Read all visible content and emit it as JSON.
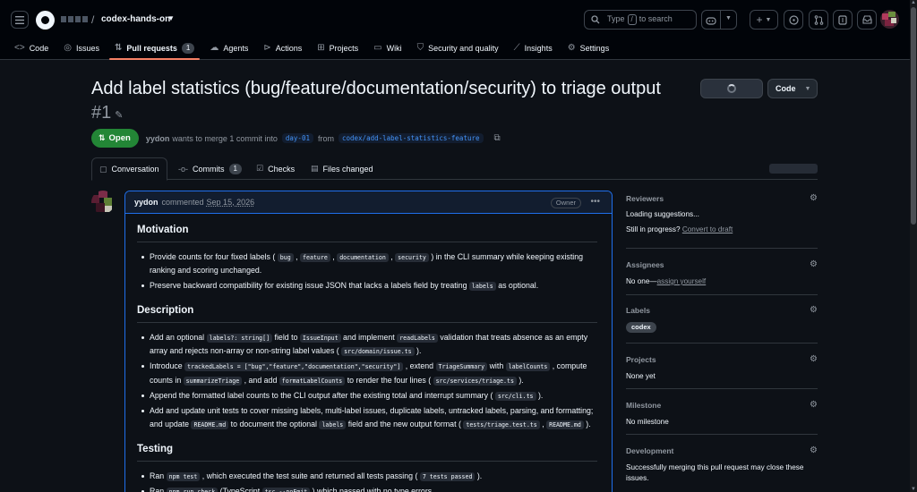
{
  "header": {
    "repo_separator": "/",
    "repo_name": "codex-hands-on",
    "search_text": "Type",
    "search_key": "/",
    "search_suffix": "to search"
  },
  "repo_tabs": [
    {
      "label": "Code",
      "icon": "code-icon"
    },
    {
      "label": "Issues",
      "icon": "issue-icon"
    },
    {
      "label": "Pull requests",
      "icon": "pull-request-icon",
      "count": "1",
      "active": true
    },
    {
      "label": "Agents",
      "icon": "agents-icon"
    },
    {
      "label": "Actions",
      "icon": "play-icon"
    },
    {
      "label": "Projects",
      "icon": "table-icon"
    },
    {
      "label": "Wiki",
      "icon": "book-icon"
    },
    {
      "label": "Security and quality",
      "icon": "shield-icon"
    },
    {
      "label": "Insights",
      "icon": "graph-icon"
    },
    {
      "label": "Settings",
      "icon": "gear-icon"
    }
  ],
  "pr": {
    "title": "Add label statistics (bug/feature/documentation/security) to triage output",
    "number": "#1",
    "code_button": "Code",
    "state": "Open",
    "author": "yydon",
    "merge_text": "wants to merge 1 commit into",
    "base_branch": "day-01",
    "from_text": "from",
    "head_branch": "codex/add-label-statistics-feature"
  },
  "pr_tabs": {
    "conversation": "Conversation",
    "commits": "Commits",
    "commits_count": "1",
    "checks": "Checks",
    "files_changed": "Files changed"
  },
  "comment": {
    "author": "yydon",
    "verb": "commented",
    "date": "Sep 15, 2026",
    "role": "Owner",
    "motivation_heading": "Motivation",
    "description_heading": "Description",
    "testing_heading": "Testing"
  },
  "sidebar": {
    "reviewers": {
      "title": "Reviewers",
      "loading": "Loading suggestions...",
      "in_progress": "Still in progress?",
      "draft_link": "Convert to draft"
    },
    "assignees": {
      "title": "Assignees",
      "none": "No one—",
      "assign_link": "assign yourself"
    },
    "labels": {
      "title": "Labels",
      "label": "codex"
    },
    "projects": {
      "title": "Projects",
      "value": "None yet"
    },
    "milestone": {
      "title": "Milestone",
      "value": "No milestone"
    },
    "development": {
      "title": "Development",
      "text": "Successfully merging this pull request may close these issues."
    }
  },
  "colors": {
    "open_badge": "#238636",
    "accent_underline": "#f78166",
    "link": "#4493f8",
    "comment_border": "#1f6feb"
  }
}
